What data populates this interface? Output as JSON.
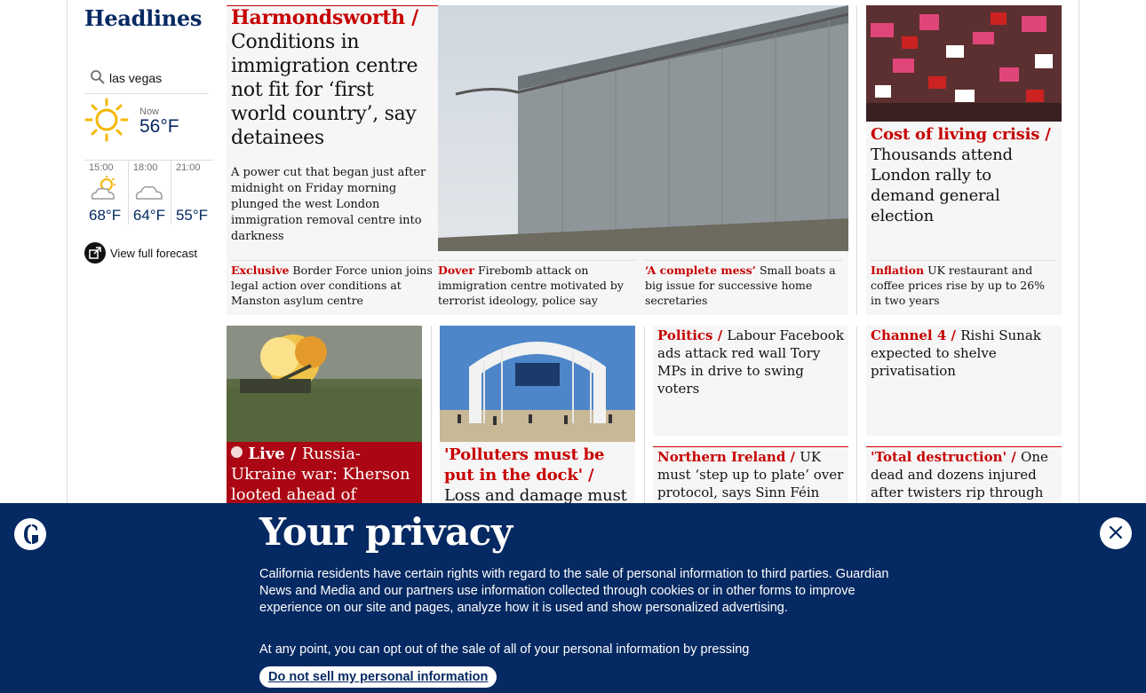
{
  "sidebar": {
    "title": "Headlines",
    "weather": {
      "location": "las vegas",
      "now_label": "Now",
      "now_temp": "56°F",
      "forecast": [
        {
          "time": "15:00",
          "temp": "68°F",
          "icon": "partly-sunny-icon"
        },
        {
          "time": "18:00",
          "temp": "64°F",
          "icon": "cloudy-icon"
        },
        {
          "time": "21:00",
          "temp": "55°F",
          "icon": "moon-icon"
        }
      ],
      "full_forecast_label": "View full forecast"
    }
  },
  "top_story": {
    "kicker": "Harmondsworth /",
    "headline": "Conditions in immigration centre not fit for ‘first world country’, say detainees",
    "standfirst": "A power cut that began just after midnight on Friday morning plunged the west London immigration removal centre into darkness",
    "sublinks": [
      {
        "kicker": "Exclusive",
        "text": "Border Force union joins legal action over conditions at Manston asylum centre"
      },
      {
        "kicker": "Dover",
        "text": "Firebomb attack on immigration centre motivated by terrorist ideology, police say"
      },
      {
        "kicker": "‘A complete mess’",
        "text": "Small boats a big issue for successive home secretaries"
      }
    ]
  },
  "side_story": {
    "kicker": "Cost of living crisis /",
    "headline": "Thousands attend London rally to demand general election",
    "sublink": {
      "kicker": "Inflation",
      "text": "UK restaurant and coffee prices rise by up to 26% in two years"
    }
  },
  "row2": [
    {
      "live": "Live /",
      "headline": "Russia-Ukraine war: Kherson looted ahead of"
    },
    {
      "kicker": "'Polluters must be put in the dock' /",
      "headline": "Loss and damage must be at"
    },
    {
      "kicker": "Politics /",
      "headline": "Labour Facebook ads attack red wall Tory MPs in drive to swing voters"
    },
    {
      "kicker": "Channel 4 /",
      "headline": "Rishi Sunak expected to shelve privatisation"
    },
    {
      "kicker": "Northern Ireland /",
      "headline": "UK must ‘step up to plate’ over protocol, says Sinn Féin"
    },
    {
      "kicker": "'Total destruction' /",
      "headline": "One dead and dozens injured after twisters rip through"
    }
  ],
  "cookie_banner": {
    "title": "Your privacy",
    "text": "California residents have certain rights with regard to the sale of personal information to third parties. Guardian News and Media and our partners use information collected through cookies or in other forms to improve experience on our site and pages, analyze how it is used and show personalized advertising.",
    "text2": "At any point, you can opt out of the sale of all of your personal information by pressing",
    "button": "Do not sell my personal information"
  },
  "colors": {
    "brand": "#052962",
    "news_red": "#c70000",
    "card_bg": "#f6f6f6",
    "live_red": "#ab0613"
  }
}
